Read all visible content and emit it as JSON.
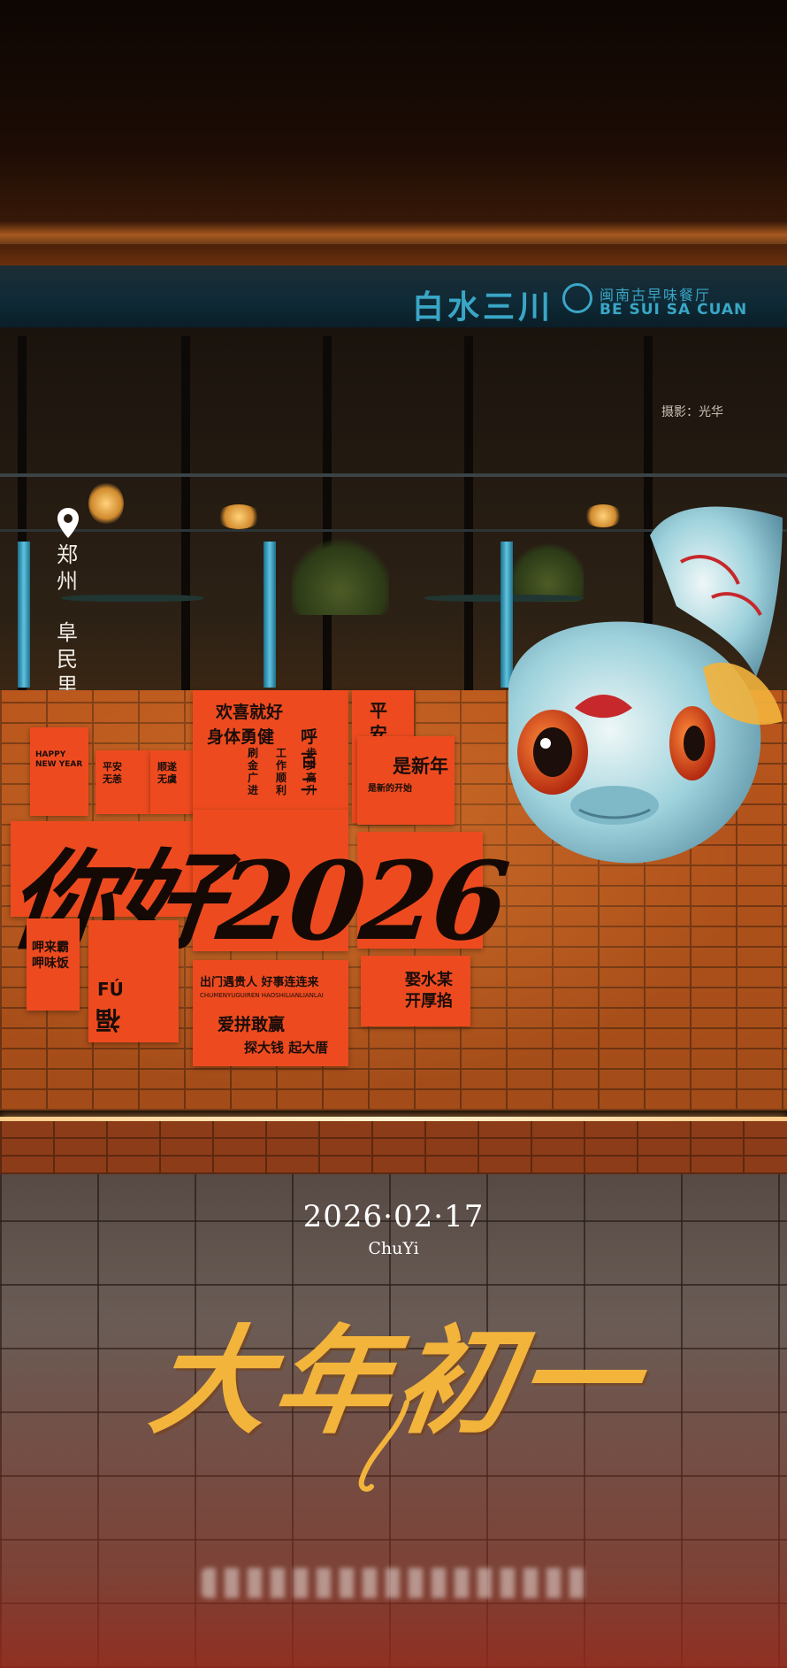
{
  "store_sign": {
    "name_cn": "白水三川",
    "subtitle_cn": "闽南古早味餐厅",
    "name_latin": "BE SUI SA CUAN"
  },
  "photo_credit": "摄影：光华",
  "location": {
    "city": "郑州",
    "street": "阜民里"
  },
  "wall_posters": {
    "happy_new_year": "HAPPY NEW YEAR",
    "peace_left": "平安无恙",
    "luck": "顺遂无虞",
    "greeting_title": "欢喜就好",
    "health": "身体勇健",
    "hu_bai_er": "呼百二",
    "steps_col1": "刷金广进",
    "steps_col2": "工作顺利",
    "steps_col3": "步步高升",
    "peace_generations": "平安無代志",
    "is_new_year": "是新年",
    "new_beginning": "是新的开始",
    "big_brush": "你好2026",
    "eat_call": "呷来霸呷味饭",
    "fu_latin": "FÚ",
    "fu_char": "福",
    "lucky_people": "出门遇贵人 好事连连来",
    "lucky_pinyin": "CHUMENYUGUIREN HAOSHILIANLIANLAI",
    "fight_to_win": "爱拼敢赢",
    "money_house": "探大钱 起大厝",
    "marry": "娶水某",
    "shop": "开厚掐"
  },
  "caption": {
    "date": "2026·02·17",
    "subtitle": "ChuYi",
    "headline": "大年初一"
  },
  "colors": {
    "sign_blue": "#3aa6c6",
    "poster_red": "#ed4b1f",
    "headline_gold": "#f3b43c",
    "brick": "#b9561c"
  }
}
